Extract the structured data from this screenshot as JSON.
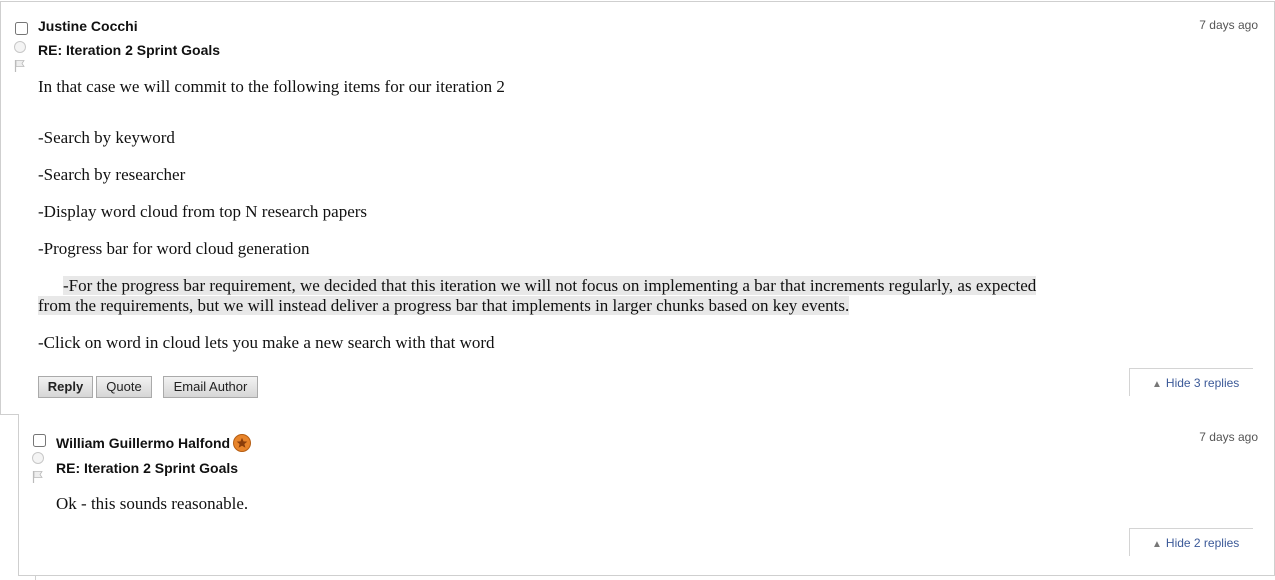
{
  "posts": [
    {
      "author": "Justine Cocchi",
      "subject": "RE: Iteration 2 Sprint Goals",
      "time": "7 days ago",
      "body": {
        "intro": "In that case we will commit to the following items for our iteration 2",
        "items": [
          "-Search by keyword",
          "-Search by researcher",
          "-Display word cloud from top N research papers",
          "-Progress bar for word cloud generation"
        ],
        "note_line1": "-For the progress bar requirement, we decided that this iteration we will not focus on implementing a bar that increments regularly, as expected",
        "note_line2": "from the requirements, but we will instead deliver a progress bar that implements in larger chunks based on key events.",
        "last_item": "-Click on word in cloud lets you make a new search with that word"
      },
      "actions": {
        "reply": "Reply",
        "quote": "Quote",
        "email": "Email Author"
      },
      "hide_replies": "Hide 3 replies"
    },
    {
      "author": "William Guillermo Halfond",
      "badge_icon": "star-badge",
      "subject": "RE: Iteration 2 Sprint Goals",
      "time": "7 days ago",
      "body": "Ok - this sounds reasonable.",
      "hide_replies": "Hide 2 replies"
    }
  ],
  "colors": {
    "link": "#3b5998",
    "highlight": "#e8e8e8",
    "badge": "#e8842a"
  }
}
